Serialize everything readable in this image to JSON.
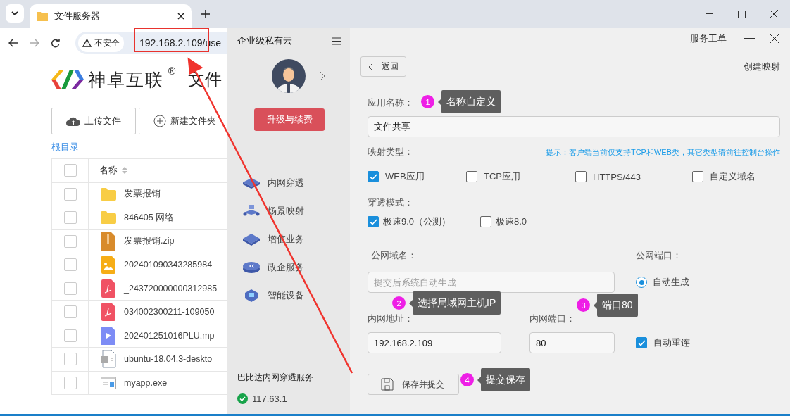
{
  "browser": {
    "tab": {
      "title": "文件服务器",
      "selected": true
    },
    "security": "不安全",
    "url": "192.168.2.109/use"
  },
  "file_page": {
    "brand": "神卓互联",
    "brand_mark": "®",
    "page_title": "文件",
    "select_all_checked": false,
    "buttons": [
      {
        "label": "上传文件",
        "kind": "upload"
      },
      {
        "label": "新建文件夹",
        "kind": "add"
      }
    ],
    "breadcrumb": "根目录",
    "name_column": "名称",
    "files": [
      {
        "name": "发票报销",
        "kind": "folder",
        "checked": false
      },
      {
        "name": "846405 网络",
        "kind": "folder",
        "checked": false
      },
      {
        "name": "发票报销.zip",
        "kind": "zip",
        "checked": false
      },
      {
        "name": "202401090343285984",
        "kind": "image",
        "checked": false
      },
      {
        "name": "_243720000000312985",
        "kind": "pdf",
        "checked": false
      },
      {
        "name": "034002300211-109050",
        "kind": "pdf",
        "checked": false
      },
      {
        "name": "202401251016PLU.mp",
        "kind": "video",
        "checked": false
      },
      {
        "name": "ubuntu-18.04.3-deskto",
        "kind": "unknown",
        "checked": false
      },
      {
        "name": "myapp.exe",
        "kind": "exe",
        "checked": false
      }
    ]
  },
  "sidebar": {
    "title": "企业级私有云",
    "upgrade_button": "升级与续费",
    "items": [
      {
        "label": "内网穿透",
        "kind": "switch"
      },
      {
        "label": "场景映射",
        "kind": "map"
      },
      {
        "label": "增值业务",
        "kind": "box"
      },
      {
        "label": "政企服务",
        "kind": "router"
      },
      {
        "label": "智能设备",
        "kind": "device"
      }
    ],
    "footer_title": "巴比达内网穿透服务",
    "server": "117.63.1"
  },
  "panel": {
    "menu": "服务工单",
    "back": "返回",
    "heading": "创建映射",
    "app_name_label": "应用名称：",
    "app_name": "文件共享",
    "type_label": "映射类型：",
    "hint": "提示：客户端当前仅支持TCP和WEB类，其它类型请前往控制台操作",
    "types": [
      {
        "label": "WEB应用",
        "checked": true
      },
      {
        "label": "TCP应用",
        "checked": false
      },
      {
        "label": "HTTPS/443",
        "checked": false
      },
      {
        "label": "自定义域名",
        "checked": false
      }
    ],
    "mode_label": "穿透模式：",
    "modes": [
      {
        "label": "极速9.0（公测）",
        "checked": true
      },
      {
        "label": "极速8.0",
        "checked": false
      }
    ],
    "domain_label": "公网域名：",
    "domain_placeholder": "提交后系统自动生成",
    "public_port_label": "公网端口：",
    "public_port_option": {
      "label": "自动生成",
      "selected": true
    },
    "lan_address_label": "内网地址：",
    "lan_address": "192.168.2.109",
    "lan_port_label": "内网端口：",
    "lan_port": "80",
    "auto_reconnect": {
      "label": "自动重连",
      "checked": true
    },
    "save_button": "保存并提交"
  },
  "annotations": [
    {
      "number": "1",
      "text": "名称自定义"
    },
    {
      "number": "2",
      "text": "选择局域网主机IP"
    },
    {
      "number": "3",
      "text": "端口80"
    },
    {
      "number": "4",
      "text": "提交保存"
    }
  ]
}
